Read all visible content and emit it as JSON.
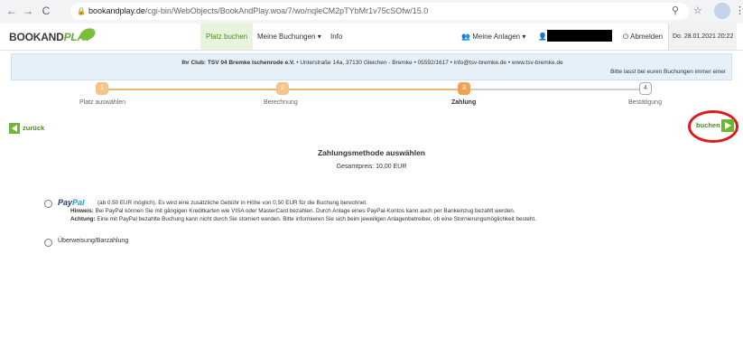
{
  "browser": {
    "url_host": "bookandplay.de",
    "url_path": "/cgi-bin/WebObjects/BookAndPlay.woa/7/wo/nqleCM2pTYbMr1v75cSOfw/15.0",
    "back": "←",
    "forward": "→",
    "reload": "C",
    "zoom": "⚲",
    "star": "☆",
    "menu": "⋮"
  },
  "header": {
    "logo_part1": "BOOKAND",
    "logo_part2": "PLAY",
    "tabs": [
      {
        "label": "Platz buchen"
      },
      {
        "label": "Meine Buchungen ▾"
      },
      {
        "label": "Info"
      }
    ],
    "facilities": "Meine Anlagen ▾",
    "logout": "Abmelden",
    "date": "Do. 28.01.2021 20:22"
  },
  "club": {
    "name": "Ihr Club: TSV 04 Bremke Ischenrode e.V.",
    "details": " • Unterstraße 14a, 37130 Gleichen - Bremke • 05592/1617 • info@tsv-bremke.de • www.tsv-bremke.de",
    "note": "Bitte lasst bei euren Buchungen immer einer"
  },
  "steps": [
    {
      "num": "1",
      "label": "Platz auswählen"
    },
    {
      "num": "2",
      "label": "Berechnung"
    },
    {
      "num": "3",
      "label": "Zahlung"
    },
    {
      "num": "4",
      "label": "Bestätigung"
    }
  ],
  "nav": {
    "back": "zurück",
    "book": "buchen"
  },
  "payment": {
    "title": "Zahlungsmethode auswählen",
    "total": "Gesamtpreis: 10,00 EUR",
    "paypal_brand1": "Pay",
    "paypal_brand2": "Pal",
    "paypal_line1": "(ab 0.50 EUR möglich). Es wird eine zusätzliche Gebühr in Höhe von 0,50 EUR für die Buchung berechnet.",
    "paypal_hint_label": "Hinweis:",
    "paypal_hint": " Bei PayPal können Sie mit gängigen Kreditkarten wie VISA oder MasterCard bezahlen. Durch Anlage eines PayPal-Kontos kann auch per Bankeinzug bezahlt werden.",
    "paypal_warn_label": "Achtung:",
    "paypal_warn": " Eine mit PayPal bezahlte Buchung kann nicht durch Sie storniert werden. Bitte informieren Sie sich beim jeweiligen Anlagenbetreiber, ob eine Stornierungsmöglichkeit besteht.",
    "transfer": "Überweisung/Barzahlung"
  },
  "colors": {
    "accent_green": "#6fb636",
    "step_orange": "#f0a451",
    "highlight_red": "#e0191b"
  },
  "icons": {
    "lock": "lock-icon",
    "people": "people-icon",
    "user": "user-icon",
    "power": "power-icon"
  }
}
